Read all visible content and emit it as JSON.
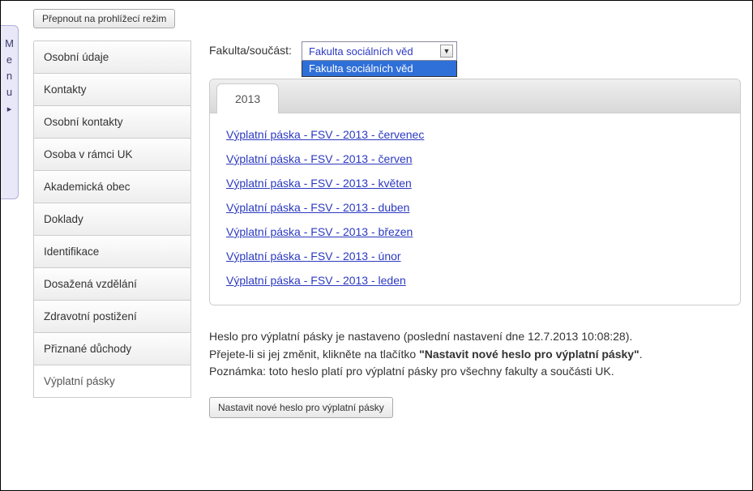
{
  "menu_tab": {
    "label": "Menu",
    "handle": "▸"
  },
  "mode_button": "Přepnout na prohlížecí režim",
  "sidebar": {
    "items": [
      {
        "label": "Osobní údaje"
      },
      {
        "label": "Kontakty"
      },
      {
        "label": "Osobní kontakty"
      },
      {
        "label": "Osoba v rámci UK"
      },
      {
        "label": "Akademická obec"
      },
      {
        "label": "Doklady"
      },
      {
        "label": "Identifikace"
      },
      {
        "label": "Dosažená vzdělání"
      },
      {
        "label": "Zdravotní postižení"
      },
      {
        "label": "Přiznané důchody"
      },
      {
        "label": "Výplatní pásky",
        "selected": true
      }
    ]
  },
  "faculty": {
    "label": "Fakulta/součást:",
    "selected": "Fakulta sociálních věd",
    "options": [
      "Fakulta sociálních věd"
    ]
  },
  "tabs": [
    {
      "label": "2013",
      "active": true
    }
  ],
  "payslips": [
    "Výplatní páska - FSV - 2013 - červenec",
    "Výplatní páska - FSV - 2013 - červen",
    "Výplatní páska - FSV - 2013 - květen",
    "Výplatní páska - FSV - 2013 - duben",
    "Výplatní páska - FSV - 2013 - březen",
    "Výplatní páska - FSV - 2013 - únor",
    "Výplatní páska - FSV - 2013 - leden"
  ],
  "info": {
    "line1_a": "Heslo pro výplatní pásky je nastaveno (poslední nastavení dne ",
    "line1_date": "12.7.2013 10:08:28",
    "line1_b": ").",
    "line2_a": "Přejete-li si jej změnit, klikněte na tlačítko ",
    "line2_bold": "\"Nastavit nové heslo pro výplatní pásky\"",
    "line2_b": ".",
    "line3": "Poznámka: toto heslo platí pro výplatní pásky pro všechny fakulty a součásti UK."
  },
  "password_button": "Nastavit nové heslo pro výplatní pásky"
}
